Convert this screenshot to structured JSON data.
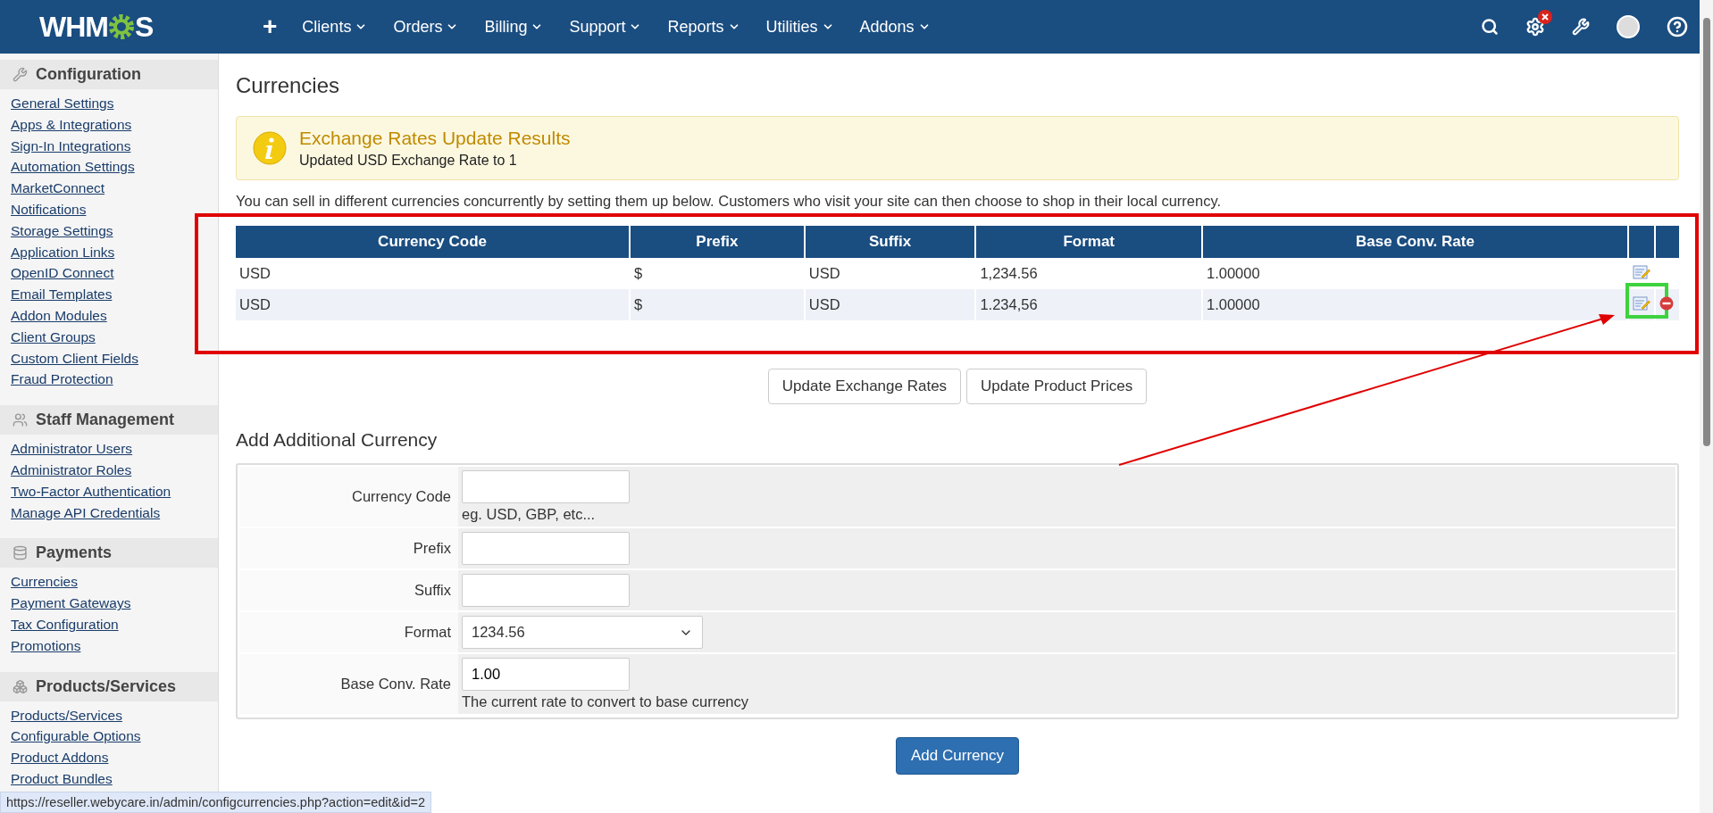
{
  "nav": {
    "logo_before": "WHM",
    "logo_after": "S",
    "add": "+",
    "menus": [
      "Clients",
      "Orders",
      "Billing",
      "Support",
      "Reports",
      "Utilities",
      "Addons"
    ]
  },
  "sidebar": [
    {
      "title": "Configuration",
      "links": [
        "General Settings",
        "Apps & Integrations",
        "Sign-In Integrations",
        "Automation Settings",
        "MarketConnect",
        "Notifications",
        "Storage Settings",
        "Application Links",
        "OpenID Connect",
        "Email Templates",
        "Addon Modules",
        "Client Groups",
        "Custom Client Fields",
        "Fraud Protection"
      ]
    },
    {
      "title": "Staff Management",
      "links": [
        "Administrator Users",
        "Administrator Roles",
        "Two-Factor Authentication",
        "Manage API Credentials"
      ]
    },
    {
      "title": "Payments",
      "links": [
        "Currencies",
        "Payment Gateways",
        "Tax Configuration",
        "Promotions"
      ]
    },
    {
      "title": "Products/Services",
      "links": [
        "Products/Services",
        "Configurable Options",
        "Product Addons",
        "Product Bundles"
      ]
    }
  ],
  "page_title": "Currencies",
  "alert": {
    "title": "Exchange Rates Update Results",
    "message": "Updated USD Exchange Rate to 1"
  },
  "intro": "You can sell in different currencies concurrently by setting them up below. Customers who visit your site can then choose to shop in their local currency.",
  "table": {
    "columns": [
      "Currency Code",
      "Prefix",
      "Suffix",
      "Format",
      "Base Conv. Rate"
    ],
    "rows": [
      {
        "cells": [
          "USD",
          "$",
          "USD",
          "1,234.56",
          "1.00000"
        ],
        "deletable": false,
        "highlighted": false
      },
      {
        "cells": [
          "USD",
          "$",
          "USD",
          "1.234,56",
          "1.00000"
        ],
        "deletable": true,
        "highlighted": true
      }
    ]
  },
  "actions": [
    "Update Exchange Rates",
    "Update Product Prices"
  ],
  "form": {
    "title": "Add Additional Currency",
    "fields": [
      {
        "label": "Currency Code",
        "kind": "text",
        "help": "eg. USD, GBP, etc..."
      },
      {
        "label": "Prefix",
        "kind": "text"
      },
      {
        "label": "Suffix",
        "kind": "text"
      },
      {
        "label": "Format",
        "kind": "select",
        "value": "1234.56"
      },
      {
        "label": "Base Conv. Rate",
        "kind": "text",
        "value": "1.00",
        "help": "The current rate to convert to base currency"
      }
    ],
    "submit": "Add Currency"
  },
  "status_bar": "https://reseller.webycare.in/admin/configcurrencies.php?action=edit&id=2"
}
